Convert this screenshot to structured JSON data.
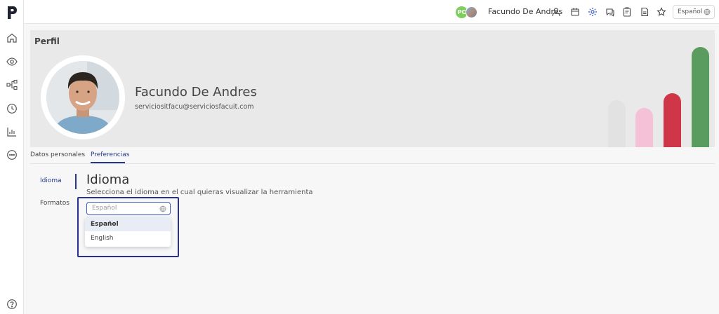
{
  "app": {
    "logo_letter": "p"
  },
  "sidebar": {
    "items": [
      {
        "icon": "home-icon"
      },
      {
        "icon": "eye-icon"
      },
      {
        "icon": "hierarchy-icon"
      },
      {
        "icon": "clock-icon"
      },
      {
        "icon": "chart-icon"
      },
      {
        "icon": "chat-dots-icon"
      }
    ],
    "help_icon": "help-icon"
  },
  "topbar": {
    "avatar_initials": "PC",
    "user_name": "Facundo De Andres",
    "language": "Español",
    "icons": [
      "user-icon",
      "calendar-icon",
      "settings-icon",
      "chat-icon",
      "clipboard-icon",
      "document-icon",
      "star-icon"
    ]
  },
  "profile": {
    "title": "Perfil",
    "name": "Facundo De Andres",
    "email": "serviciositfacu@serviciosfacuit.com",
    "decor_colors": [
      "#e2e2e2",
      "#f5c1d6",
      "#cf3647",
      "#5a9b5f"
    ]
  },
  "tabs": [
    {
      "label": "Datos personales",
      "active": false
    },
    {
      "label": "Preferencias",
      "active": true
    }
  ],
  "preferences": {
    "nav": [
      {
        "label": "Idioma",
        "active": true
      },
      {
        "label": "Formatos",
        "active": false
      }
    ],
    "section_title": "Idioma",
    "section_description": "Selecciona el idioma en el cual quieras visualizar la herramienta",
    "select_placeholder": "Español",
    "options": [
      {
        "label": "Español",
        "selected": true
      },
      {
        "label": "English",
        "selected": false
      }
    ]
  }
}
